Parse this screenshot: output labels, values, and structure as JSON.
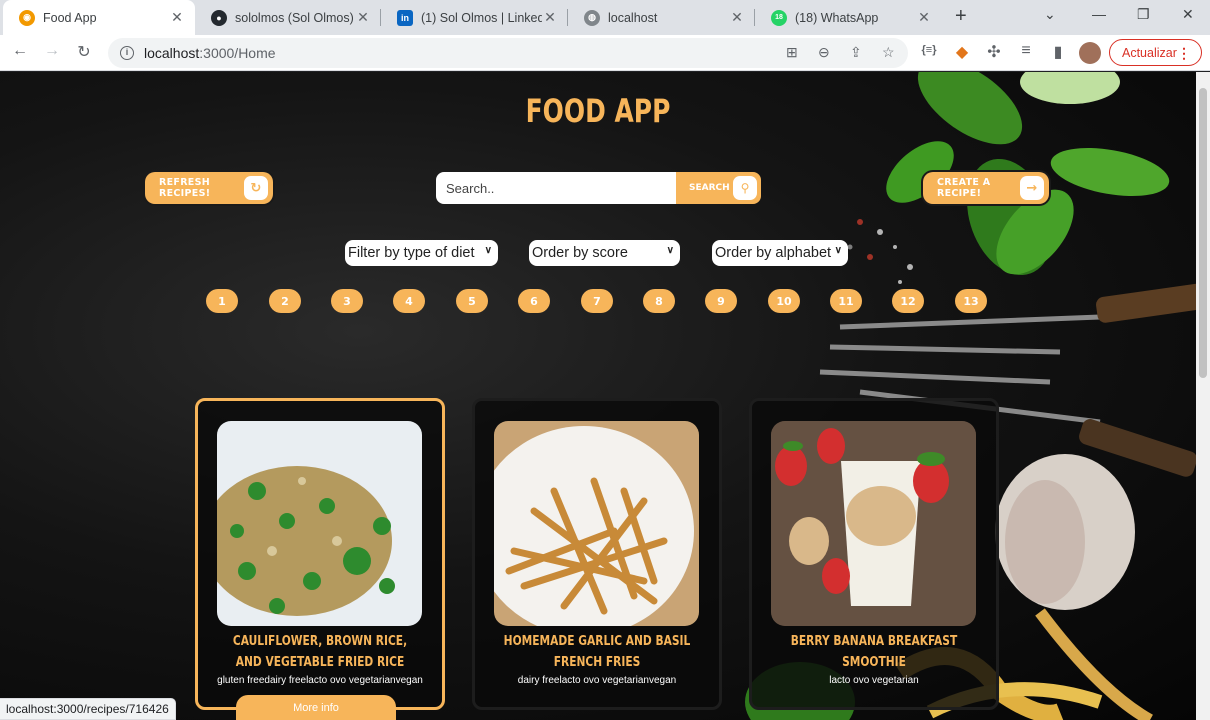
{
  "browser": {
    "tabs": [
      {
        "title": "Food App",
        "favicon_color": "#f29900",
        "active": true
      },
      {
        "title": "sololmos (Sol Olmos)",
        "favicon_color": "#24292f",
        "active": false
      },
      {
        "title": "(1) Sol Olmos | LinkedIn",
        "favicon_color": "#0a66c2",
        "active": false
      },
      {
        "title": "localhost",
        "favicon_color": "#80868b",
        "active": false
      },
      {
        "title": "(18) WhatsApp",
        "favicon_color": "#25d366",
        "active": false
      }
    ],
    "url_host": "localhost",
    "url_rest": ":3000/Home",
    "update_label": "Actualizar",
    "status_url": "localhost:3000/recipes/716426"
  },
  "app": {
    "title": "FOOD APP",
    "refresh_label": "REFRESH RECIPES!",
    "search_placeholder": "Search..",
    "search_label": "SEARCH",
    "create_label": "CREATE A RECIPE!",
    "filters": {
      "diet": "Filter by type of diet",
      "score": "Order by score",
      "alphabet": "Order by alphabet"
    },
    "pages": [
      "1",
      "2",
      "3",
      "4",
      "5",
      "6",
      "7",
      "8",
      "9",
      "10",
      "11",
      "12",
      "13"
    ],
    "cards": [
      {
        "name": "CAULIFLOWER, BROWN RICE, AND VEGETABLE FRIED RICE",
        "diets": "gluten freedairy freelacto ovo vegetarianvegan",
        "selected": true
      },
      {
        "name": "HOMEMADE GARLIC AND BASIL FRENCH FRIES",
        "diets": "dairy freelacto ovo vegetarianvegan",
        "selected": false
      },
      {
        "name": "BERRY BANANA BREAKFAST SMOOTHIE",
        "diets": "lacto ovo vegetarian",
        "selected": false
      }
    ],
    "more_info_label": "More info",
    "accent_color": "#f7b55a"
  }
}
